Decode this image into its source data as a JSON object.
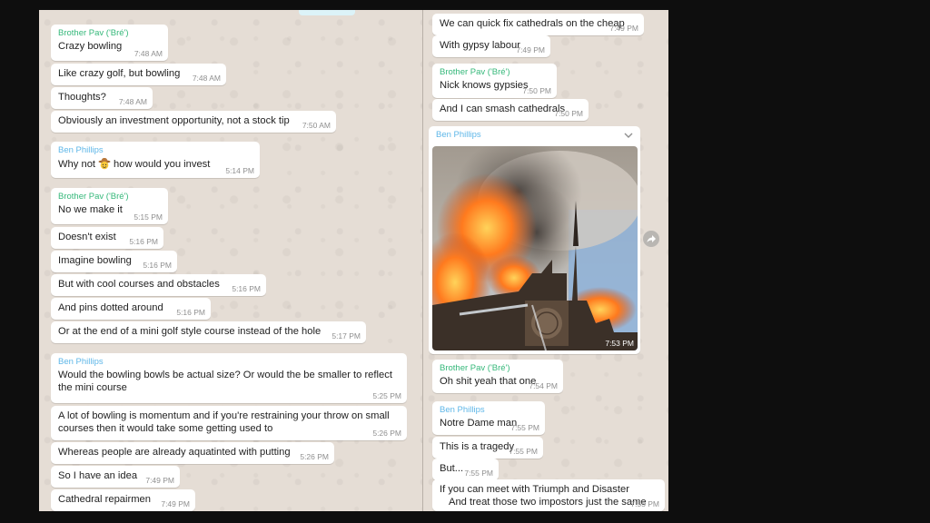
{
  "left": {
    "messages": [
      {
        "sender": "Brother Pav ('Bré')",
        "text": "Crazy bowling",
        "time": "7:48 AM"
      },
      {
        "text": "Like crazy golf, but bowling",
        "time": "7:48 AM"
      },
      {
        "text": "Thoughts?",
        "time": "7:48 AM"
      },
      {
        "text": "Obviously an investment opportunity, not a stock tip",
        "time": "7:50 AM"
      },
      {
        "sender": "Ben Phillips",
        "text_before": "Why not",
        "text_after": "how would you invest",
        "time": "5:14 PM"
      },
      {
        "sender": "Brother Pav ('Bré')",
        "text": "No we make it",
        "time": "5:15 PM"
      },
      {
        "text": "Doesn't exist",
        "time": "5:16 PM"
      },
      {
        "text": "Imagine bowling",
        "time": "5:16 PM"
      },
      {
        "text": "But with cool courses and obstacles",
        "time": "5:16 PM"
      },
      {
        "text": "And pins dotted around",
        "time": "5:16 PM"
      },
      {
        "text": "Or at the end of a mini golf style course instead of the hole",
        "time": "5:17 PM"
      },
      {
        "sender": "Ben Phillips",
        "line1": "Would the bowling bowls be actual size? Or would the be smaller to reflect",
        "line2": "the mini course",
        "time": "5:25 PM"
      },
      {
        "line1": "A lot of bowling is momentum and if you're restraining your throw on small",
        "line2": "courses then it would take some getting used to",
        "time": "5:26 PM"
      },
      {
        "text": "Whereas people are already aquatinted with putting",
        "time": "5:26 PM"
      },
      {
        "text": "So I have an idea",
        "time": "7:49 PM"
      },
      {
        "text": "Cathedral repairmen",
        "time": "7:49 PM"
      }
    ]
  },
  "right": {
    "messages": [
      {
        "text": "We can quick fix cathedrals on the cheap",
        "time": "7:49 PM"
      },
      {
        "text": "With gypsy labour",
        "time": "7:49 PM"
      },
      {
        "sender": "Brother Pav ('Bré')",
        "text": "Nick knows gypsies",
        "time": "7:50 PM"
      },
      {
        "text": "And I can smash cathedrals",
        "time": "7:50 PM"
      },
      {
        "sender": "Ben Phillips",
        "time": "7:53 PM"
      },
      {
        "sender": "Brother Pav ('Bré')",
        "text": "Oh shit yeah that one",
        "time": "7:54 PM"
      },
      {
        "sender": "Ben Phillips",
        "text": "Notre Dame man",
        "time": "7:55 PM"
      },
      {
        "text": "This is a tragedy",
        "time": "7:55 PM"
      },
      {
        "text": "But...",
        "time": "7:55 PM"
      },
      {
        "line1": "If you can meet with Triumph and Disaster",
        "line2": "And treat those two impostors just the same",
        "time": "7:55 PM"
      }
    ]
  },
  "colors": {
    "brother_pav": "#35b87a",
    "ben_phillips": "#5fb7e8",
    "bubble": "#ffffff",
    "chat_bg": "#e5ddd5"
  },
  "icons": {
    "emoji": "cowboy-face-emoji",
    "chevron": "chevron-down-icon",
    "forward": "forward-share-icon"
  }
}
